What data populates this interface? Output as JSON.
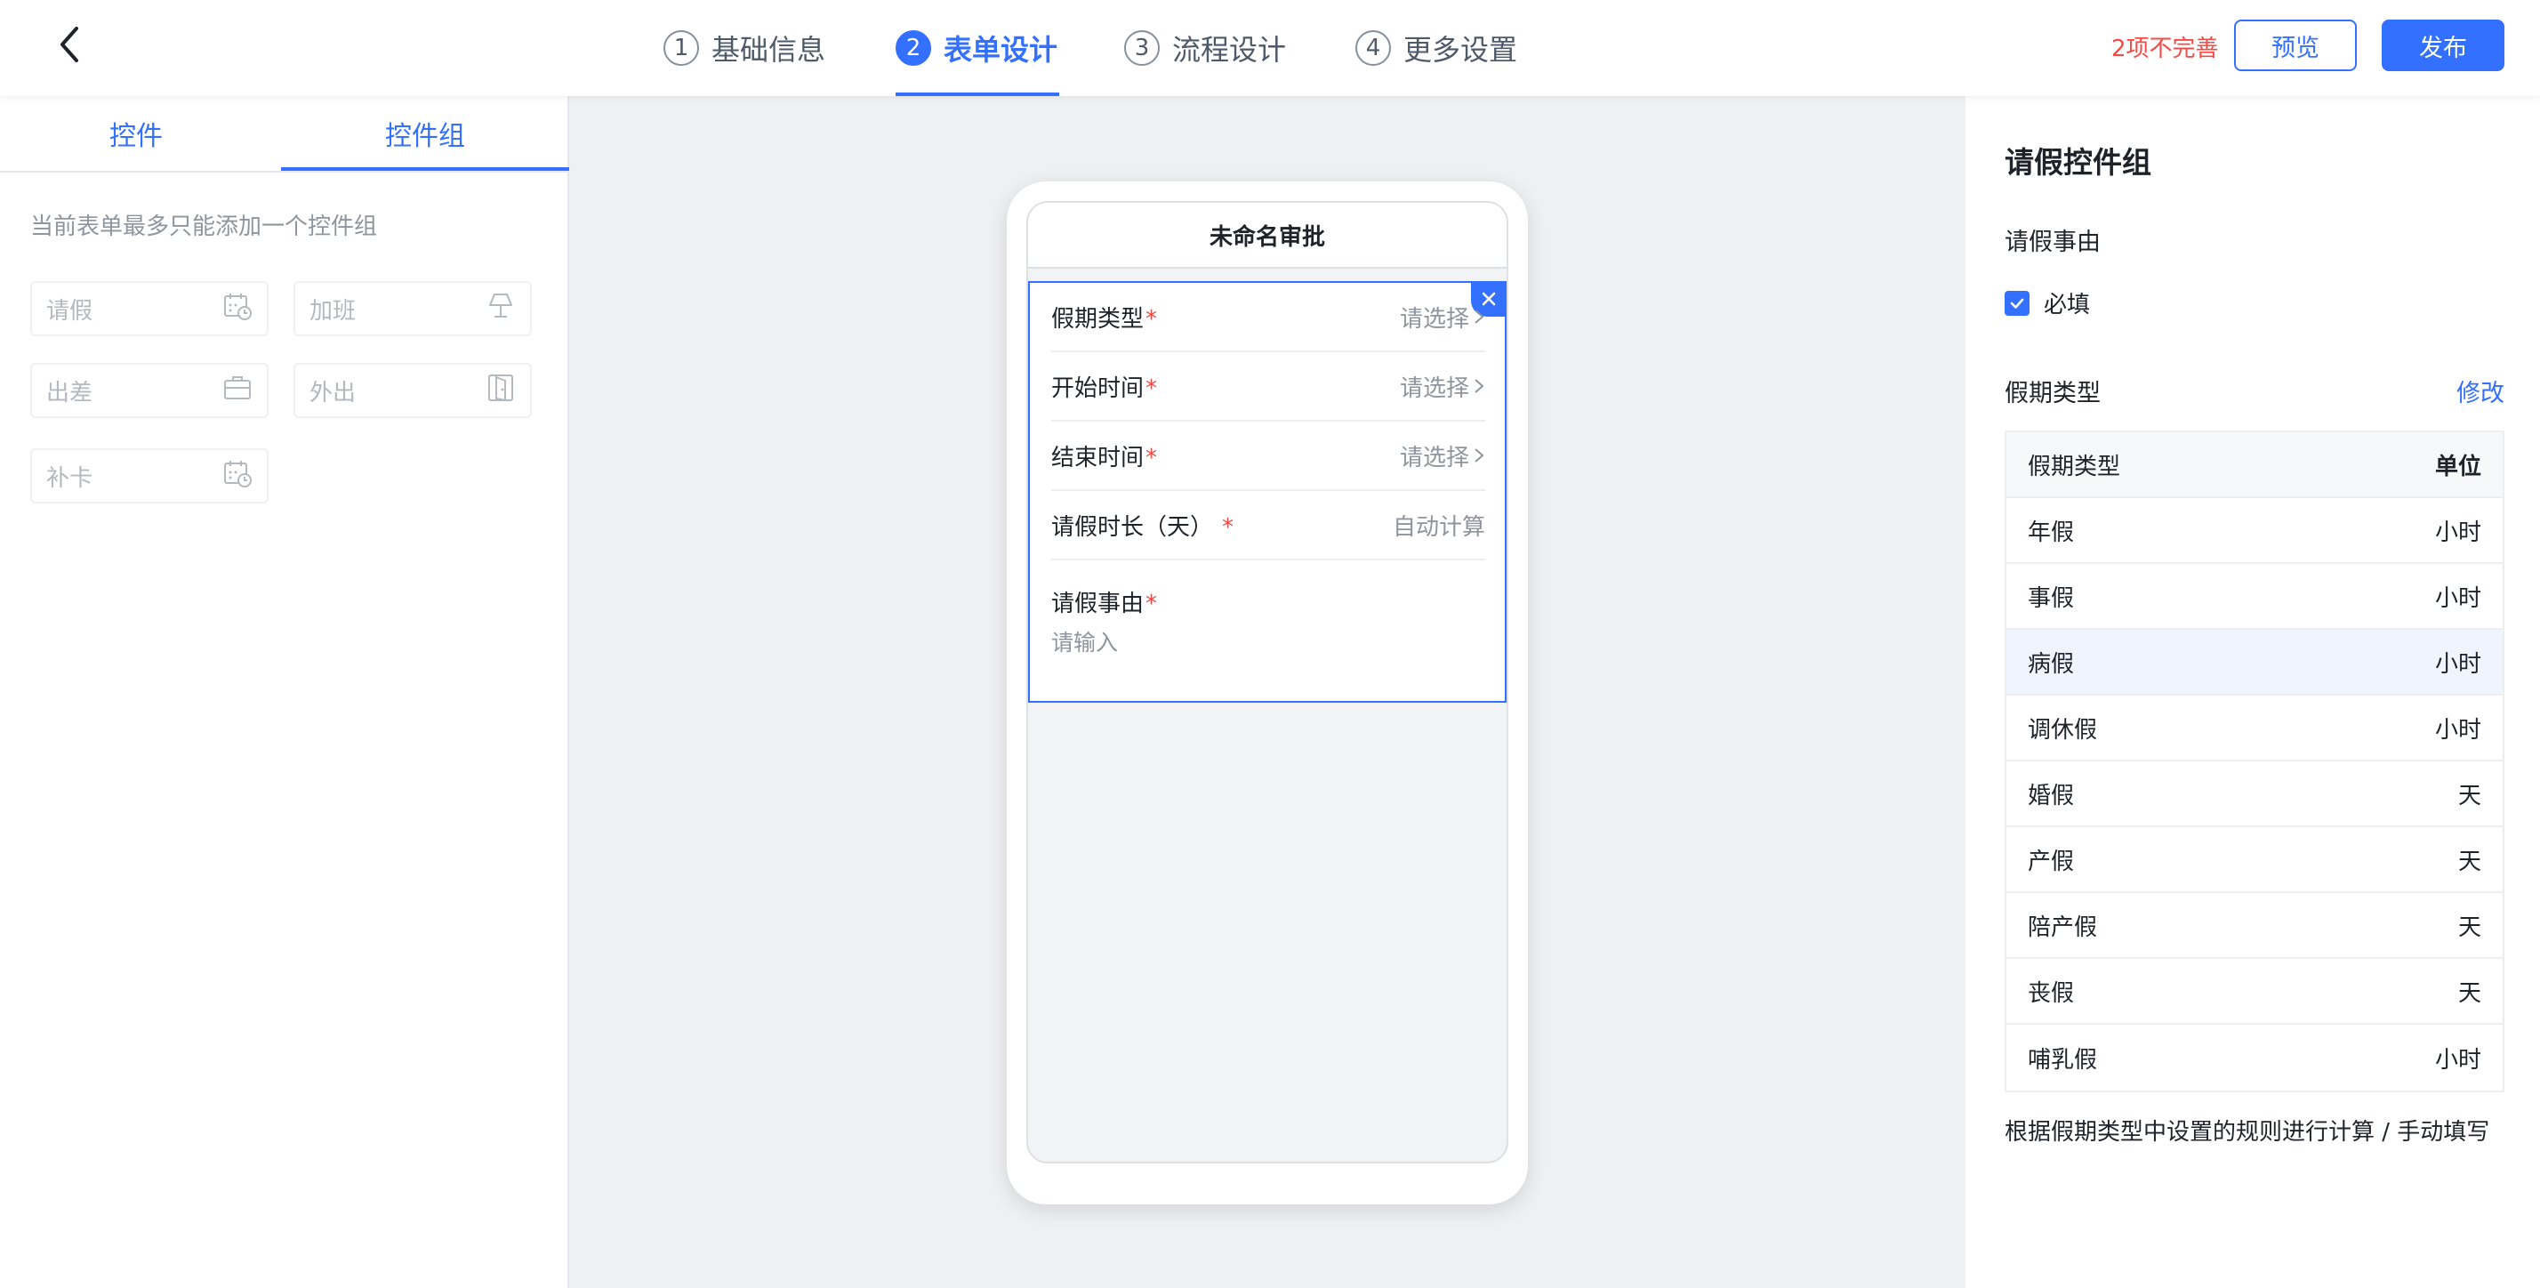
{
  "header": {
    "steps": [
      {
        "num": "1",
        "label": "基础信息"
      },
      {
        "num": "2",
        "label": "表单设计"
      },
      {
        "num": "3",
        "label": "流程设计"
      },
      {
        "num": "4",
        "label": "更多设置"
      }
    ],
    "active_step": 2,
    "warning": "2项不完善",
    "preview_label": "预览",
    "publish_label": "发布"
  },
  "left_panel": {
    "tabs": [
      "控件",
      "控件组"
    ],
    "active_tab": "控件组",
    "hint": "当前表单最多只能添加一个控件组",
    "groups": [
      {
        "label": "请假",
        "icon": "calendar-clock-icon"
      },
      {
        "label": "加班",
        "icon": "lamp-icon"
      },
      {
        "label": "出差",
        "icon": "briefcase-icon"
      },
      {
        "label": "外出",
        "icon": "door-icon"
      },
      {
        "label": "补卡",
        "icon": "calendar-clock-icon"
      }
    ]
  },
  "form": {
    "title": "未命名审批",
    "fields": [
      {
        "label": "假期类型",
        "value": "请选择"
      },
      {
        "label": "开始时间",
        "value": "请选择"
      },
      {
        "label": "结束时间",
        "value": "请选择"
      },
      {
        "label": "请假时长（天）",
        "value": "自动计算"
      }
    ],
    "reason_label": "请假事由",
    "reason_placeholder": "请输入",
    "required_mark": "*"
  },
  "right_panel": {
    "title": "请假控件组",
    "subtitle": "请假事由",
    "required_label": "必填",
    "required_checked": true,
    "leave_type_label": "假期类型",
    "modify_label": "修改",
    "table": {
      "headers": [
        "假期类型",
        "单位"
      ],
      "rows": [
        {
          "type": "年假",
          "unit": "小时"
        },
        {
          "type": "事假",
          "unit": "小时"
        },
        {
          "type": "病假",
          "unit": "小时"
        },
        {
          "type": "调休假",
          "unit": "小时"
        },
        {
          "type": "婚假",
          "unit": "天"
        },
        {
          "type": "产假",
          "unit": "天"
        },
        {
          "type": "陪产假",
          "unit": "天"
        },
        {
          "type": "丧假",
          "unit": "天"
        },
        {
          "type": "哺乳假",
          "unit": "小时"
        }
      ],
      "highlighted_row": "病假"
    },
    "note": "根据假期类型中设置的规则进行计算 / 手动填写"
  },
  "colors": {
    "accent": "#3370ff",
    "danger": "#f54a45"
  }
}
